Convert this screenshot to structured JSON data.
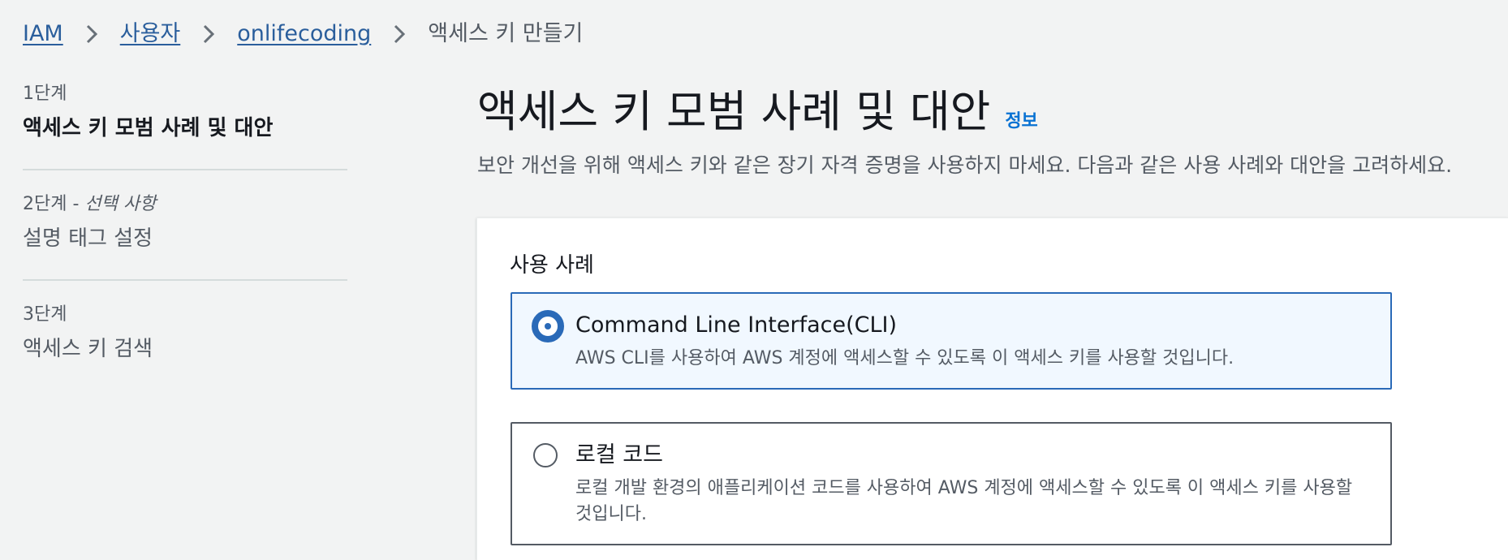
{
  "breadcrumb": {
    "items": [
      "IAM",
      "사용자",
      "onlifecoding"
    ],
    "current": "액세스 키 만들기"
  },
  "steps": [
    {
      "number": "1단계",
      "optional": "",
      "title": "액세스 키 모범 사례 및 대안"
    },
    {
      "number": "2단계 - ",
      "optional": "선택 사항",
      "title": "설명 태그 설정"
    },
    {
      "number": "3단계",
      "optional": "",
      "title": "액세스 키 검색"
    }
  ],
  "main": {
    "title": "액세스 키 모범 사례 및 대안",
    "info_label": "정보",
    "description": "보안 개선을 위해 액세스 키와 같은 장기 자격 증명을 사용하지 마세요. 다음과 같은 사용 사례와 대안을 고려하세요."
  },
  "use_case": {
    "label": "사용 사례",
    "options": [
      {
        "title": "Command Line Interface(CLI)",
        "description": "AWS CLI를 사용하여 AWS 계정에 액세스할 수 있도록 이 액세스 키를 사용할 것입니다.",
        "selected": true
      },
      {
        "title": "로컬 코드",
        "description": "로컬 개발 환경의 애플리케이션 코드를 사용하여 AWS 계정에 액세스할 수 있도록 이 액세스 키를 사용할 것입니다.",
        "selected": false
      }
    ]
  },
  "colors": {
    "link": "#2a5e9c",
    "accent": "#2a6ab8",
    "background": "#f2f3f3"
  }
}
